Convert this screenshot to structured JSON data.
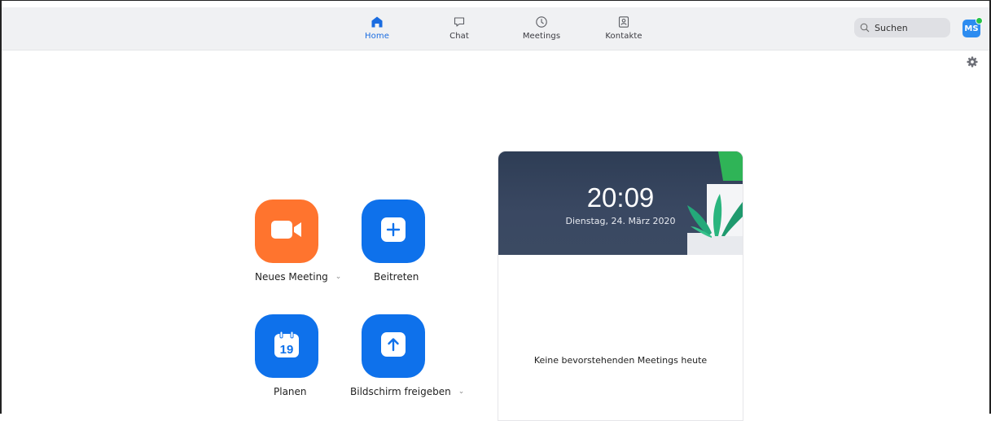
{
  "nav": {
    "tabs": [
      {
        "label": "Home",
        "icon": "home-icon",
        "active": true
      },
      {
        "label": "Chat",
        "icon": "chat-icon",
        "active": false
      },
      {
        "label": "Meetings",
        "icon": "clock-icon",
        "active": false
      },
      {
        "label": "Kontakte",
        "icon": "contacts-icon",
        "active": false
      }
    ]
  },
  "search": {
    "placeholder": "Suchen",
    "icon": "search-icon"
  },
  "user": {
    "initials": "MS",
    "status_color": "#27c248"
  },
  "settings": {
    "icon": "gear-icon"
  },
  "actions": [
    {
      "label": "Neues Meeting",
      "icon": "video-camera-icon",
      "color": "#ff742e",
      "has_dropdown": true
    },
    {
      "label": "Beitreten",
      "icon": "plus-icon",
      "color": "#0e71eb",
      "has_dropdown": false
    },
    {
      "label": "Planen",
      "icon": "calendar-icon",
      "calendar_day": "19",
      "color": "#0e71eb",
      "has_dropdown": false
    },
    {
      "label": "Bildschirm freigeben",
      "icon": "arrow-up-icon",
      "color": "#0e71eb",
      "has_dropdown": true
    }
  ],
  "meetings_panel": {
    "time": "20:09",
    "date": "Dienstag, 24. März 2020",
    "empty_message": "Keine bevorstehenden Meetings heute"
  },
  "colors": {
    "accent": "#0e71eb",
    "active_tab": "#1a6ce0",
    "header_bg": "#2e3d55"
  }
}
